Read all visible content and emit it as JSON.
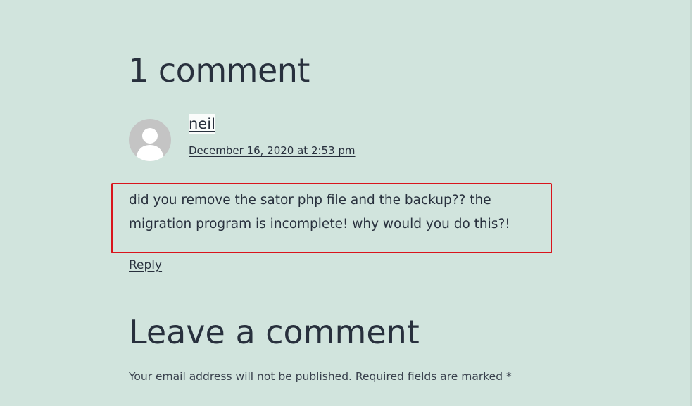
{
  "comments": {
    "title": "1 comment",
    "items": [
      {
        "author": "neil",
        "date": "December 16, 2020 at 2:53 pm",
        "text": "did you remove the sator php file and the backup?? the migration program is incomplete! why would you do this?!",
        "reply_label": "Reply",
        "avatar_icon": "default-user-avatar-icon"
      }
    ]
  },
  "respond": {
    "title": "Leave a comment",
    "email_notice": "Your email address will not be published.",
    "required_notice": "Required fields are marked",
    "required_marker": "*"
  },
  "colors": {
    "background": "#d1e4dd",
    "text": "#28303d",
    "highlight_border": "#d9141c"
  }
}
